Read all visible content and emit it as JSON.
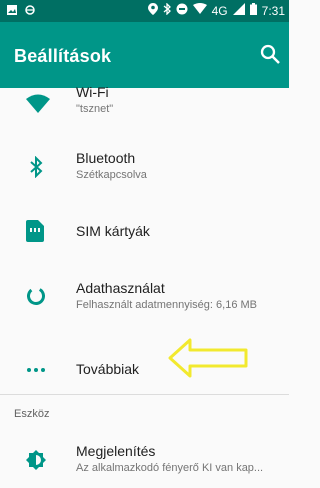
{
  "status_bar": {
    "network_label": "4G",
    "time": "7:31"
  },
  "app_bar": {
    "title": "Beállítások",
    "search_icon": "search-icon"
  },
  "items": [
    {
      "key": "wifi",
      "icon": "wifi-icon",
      "title": "Wi-Fi",
      "subtitle": "\"tsznet\""
    },
    {
      "key": "bluetooth",
      "icon": "bluetooth-icon",
      "title": "Bluetooth",
      "subtitle": "Szétkapcsolva"
    },
    {
      "key": "sim",
      "icon": "sim-card-icon",
      "title": "SIM kártyák"
    },
    {
      "key": "data",
      "icon": "data-usage-icon",
      "title": "Adathasználat",
      "subtitle": "Felhasznált adatmennyiség: 6,16 MB"
    },
    {
      "key": "more",
      "icon": "more-icon",
      "title": "Továbbiak"
    },
    {
      "key": "display",
      "icon": "brightness-icon",
      "title": "Megjelenítés",
      "subtitle": "Az alkalmazkodó fényerő KI van kap..."
    }
  ],
  "section": {
    "device_label": "Eszköz"
  },
  "colors": {
    "accent": "#009688",
    "status_bar": "#006f63",
    "arrow": "#f2e92e"
  }
}
